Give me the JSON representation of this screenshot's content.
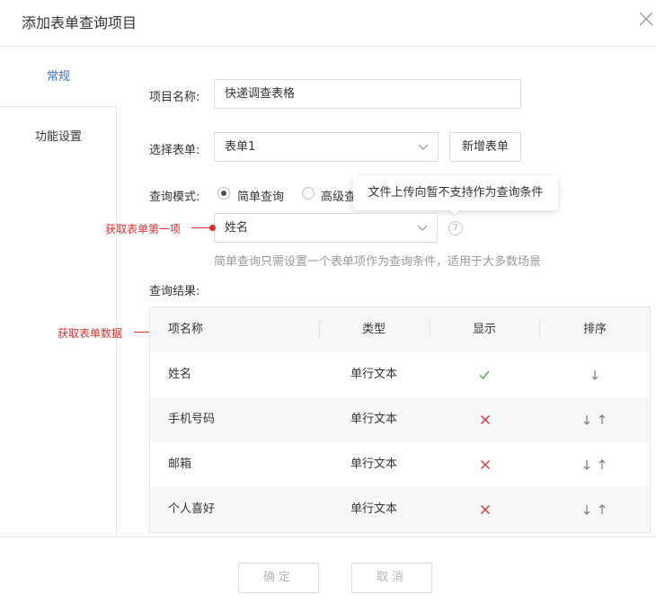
{
  "dialog": {
    "title": "添加表单查询项目"
  },
  "nav": {
    "items": [
      {
        "label": "常规"
      },
      {
        "label": "功能设置"
      }
    ]
  },
  "form": {
    "project_name_label": "项目名称:",
    "project_name_value": "快递调查表格",
    "select_form_label": "选择表单:",
    "select_form_value": "表单1",
    "new_form_button": "新增表单",
    "query_mode_label": "查询模式:",
    "mode_simple": "简单查询",
    "mode_advanced": "高级查",
    "field_value": "姓名",
    "hint": "简单查询只需设置一个表单项作为查询条件，适用于大多数场景",
    "result_label": "查询结果:"
  },
  "tooltip": {
    "text": "文件上传向暂不支持作为查询条件"
  },
  "help": {
    "glyph": "?"
  },
  "annotations": {
    "first_item": "获取表单第一项",
    "form_data": "获取表单数据"
  },
  "table": {
    "headers": [
      "项名称",
      "类型",
      "显示",
      "排序"
    ],
    "rows": [
      {
        "name": "姓名",
        "type": "单行文本",
        "shown": true,
        "sort": "down"
      },
      {
        "name": "手机号码",
        "type": "单行文本",
        "shown": false,
        "sort": "both"
      },
      {
        "name": "邮箱",
        "type": "单行文本",
        "shown": false,
        "sort": "both"
      },
      {
        "name": "个人喜好",
        "type": "单行文本",
        "shown": false,
        "sort": "both"
      }
    ]
  },
  "footer": {
    "ok": "确定",
    "cancel": "取消"
  },
  "colors": {
    "accent": "#3a6fd1",
    "check": "#52b043",
    "cross": "#e0302e",
    "annotation": "#e0302e"
  }
}
